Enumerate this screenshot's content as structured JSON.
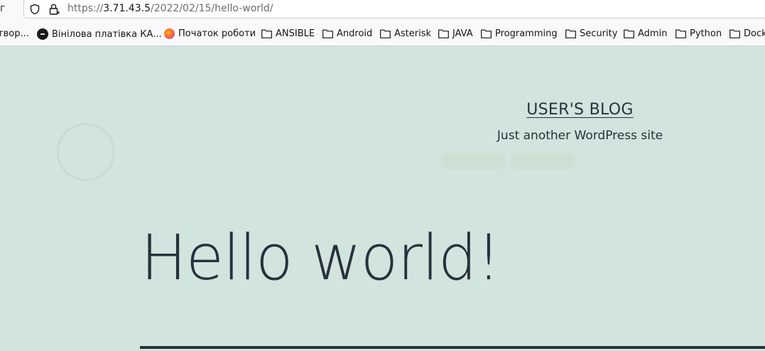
{
  "browser": {
    "left_edge_glyph": "г",
    "url": {
      "scheme": "https://",
      "host": "3.71.43.5",
      "path": "/2022/02/15/hello-world/"
    },
    "bookmarks": [
      {
        "label": "твор...",
        "icon": "none"
      },
      {
        "label": "Вінілова платівка КА...",
        "icon": "dark-circle-icon"
      },
      {
        "label": "Початок роботи",
        "icon": "firefox-icon"
      },
      {
        "label": "ANSIBLE",
        "icon": "folder-icon"
      },
      {
        "label": "Android",
        "icon": "folder-icon"
      },
      {
        "label": "Asterisk",
        "icon": "folder-icon"
      },
      {
        "label": "JAVA",
        "icon": "folder-icon"
      },
      {
        "label": "Programming",
        "icon": "folder-icon"
      },
      {
        "label": "Security",
        "icon": "folder-icon"
      },
      {
        "label": "Admin",
        "icon": "folder-icon"
      },
      {
        "label": "Python",
        "icon": "folder-icon"
      },
      {
        "label": "Dock",
        "icon": "folder-icon"
      }
    ]
  },
  "site": {
    "title": "USER'S BLOG",
    "description": "Just another WordPress site"
  },
  "post": {
    "title": "Hello world!"
  },
  "colors": {
    "background": "#d1e4dd",
    "text": "#28303d"
  }
}
